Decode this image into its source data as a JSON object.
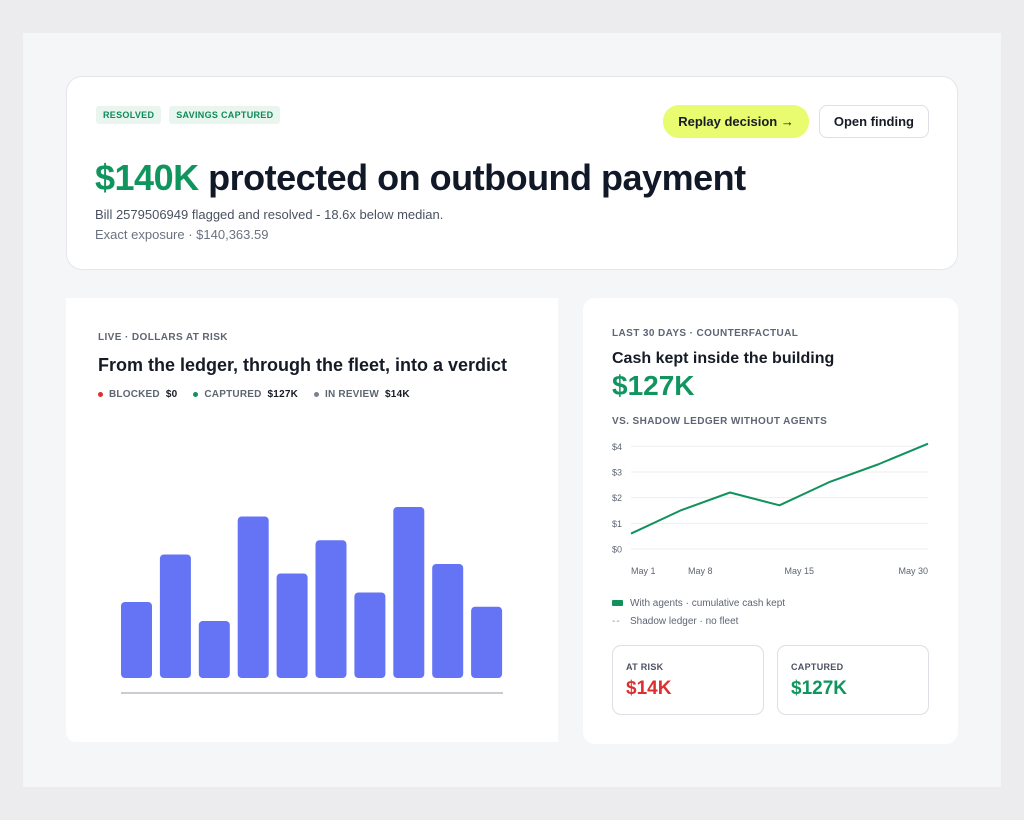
{
  "hero": {
    "badges": [
      "RESOLVED",
      "SAVINGS CAPTURED"
    ],
    "replay_label": "Replay decision →",
    "open_label": "Open finding",
    "title_amount": "$140K",
    "title_rest": "protected on outbound payment",
    "subtitle": "Bill 2579506949 flagged and resolved - 18.6x below median.",
    "exposure": "Exact exposure · $140,363.59"
  },
  "left_panel": {
    "eyebrow": "LIVE · DOLLARS AT RISK",
    "title": "From the ledger, through the fleet, into a verdict",
    "legend": [
      {
        "label": "BLOCKED",
        "value": "$0",
        "color": "#dc3030"
      },
      {
        "label": "CAPTURED",
        "value": "$127K",
        "color": "#12915d"
      },
      {
        "label": "IN REVIEW",
        "value": "$14K",
        "color": "#7b8190"
      }
    ],
    "bar_color": "#6474f5"
  },
  "right_panel": {
    "eyebrow": "LAST 30 DAYS · COUNTERFACTUAL",
    "title": "Cash kept inside the building",
    "big_value": "$127K",
    "chart_eyebrow": "VS. SHADOW LEDGER WITHOUT AGENTS",
    "legend": [
      {
        "label": "With agents · cumulative cash kept"
      },
      {
        "label": "Shadow ledger · no fleet"
      }
    ],
    "stats": [
      {
        "label": "AT RISK",
        "value": "$14K"
      },
      {
        "label": "CAPTURED",
        "value": "$127K"
      }
    ]
  },
  "chart_data": [
    {
      "type": "bar",
      "title": "",
      "values": [
        3.2,
        5.2,
        2.4,
        6.8,
        4.4,
        5.8,
        3.6,
        7.2,
        4.8,
        3.0
      ],
      "ylim": [
        0,
        8
      ],
      "color": "#6474f5",
      "grid": false
    },
    {
      "type": "line",
      "title": "",
      "x": [
        0,
        1,
        2,
        3,
        4,
        5,
        6
      ],
      "x_tick_labels": [
        {
          "pos": 0,
          "label": "May 1"
        },
        {
          "pos": 1.4,
          "label": "May 8"
        },
        {
          "pos": 3.4,
          "label": "May 15"
        },
        {
          "pos": 6,
          "label": "May 30"
        }
      ],
      "series": [
        {
          "name": "With agents · cumulative cash kept",
          "values": [
            0.6,
            1.5,
            2.2,
            1.7,
            2.6,
            3.3,
            4.1
          ],
          "color": "#12915d"
        }
      ],
      "y_ticks": [
        "$0",
        "$1",
        "$2",
        "$3",
        "$4"
      ],
      "ylim": [
        0,
        4.4
      ],
      "grid": true
    }
  ]
}
